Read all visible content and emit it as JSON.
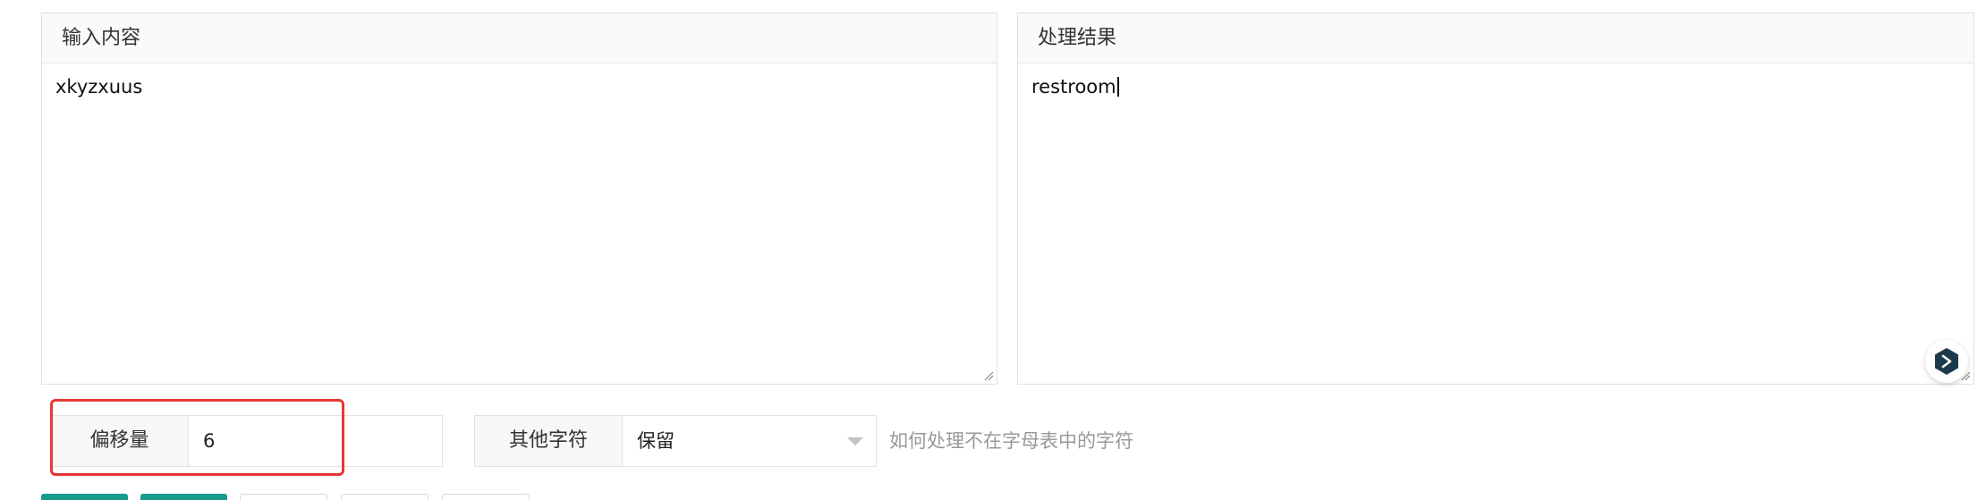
{
  "input_panel": {
    "title": "输入内容",
    "value": "xkyzxuus"
  },
  "output_panel": {
    "title": "处理结果",
    "value": "restroom"
  },
  "options": {
    "offset_label": "偏移量",
    "offset_value": "6",
    "other_chars_label": "其他字符",
    "other_chars_value": "保留",
    "other_chars_hint": "如何处理不在字母表中的字符"
  },
  "colors": {
    "primary": "#159a8c",
    "highlight": "#e53935",
    "floating_icon": "#1b3a4b"
  },
  "icons": {
    "floating": "ai-assistant-icon",
    "resize": "resize-grip-icon",
    "select": "chevron-down-icon"
  }
}
